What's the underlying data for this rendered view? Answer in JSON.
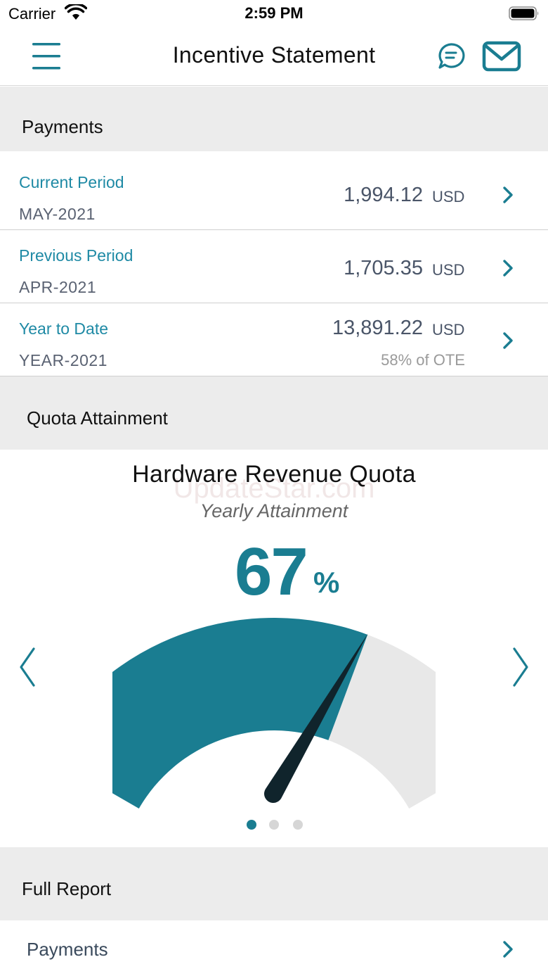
{
  "status_bar": {
    "carrier": "Carrier",
    "time": "2:59 PM"
  },
  "nav": {
    "title": "Incentive Statement",
    "menu_icon": "hamburger-menu-icon",
    "chat_icon": "chat-bubble-icon",
    "mail_icon": "mail-icon"
  },
  "payments": {
    "header": "Payments",
    "rows": [
      {
        "label": "Current Period",
        "period": "MAY-2021",
        "amount": "1,994.12",
        "currency": "USD",
        "sub": ""
      },
      {
        "label": "Previous Period",
        "period": "APR-2021",
        "amount": "1,705.35",
        "currency": "USD",
        "sub": ""
      },
      {
        "label": "Year to Date",
        "period": "YEAR-2021",
        "amount": "13,891.22",
        "currency": "USD",
        "sub": "58% of OTE"
      }
    ]
  },
  "quota": {
    "header": "Quota Attainment",
    "title": "Hardware Revenue Quota",
    "subtitle": "Yearly Attainment",
    "percent": "67",
    "percent_symbol": "%",
    "attainment_fraction": 0.67,
    "watermark": "UpdateStar.com",
    "carousel": {
      "page_count": 3,
      "active_index": 0
    }
  },
  "full_report": {
    "header": "Full Report",
    "items": [
      {
        "label": "Payments"
      }
    ]
  },
  "colors": {
    "accent": "#1a7d91",
    "label_blue": "#1f8aa5",
    "gauge_fill": "#1a7d91",
    "gauge_track": "#e8e8e8",
    "needle": "#10242c",
    "section_bg": "#ececec"
  }
}
